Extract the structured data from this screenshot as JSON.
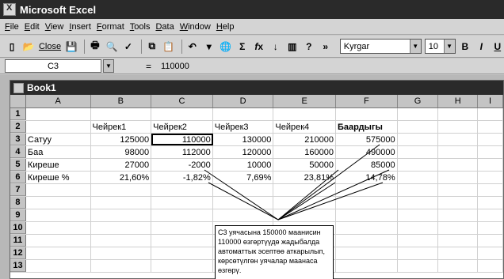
{
  "app": {
    "title": "Microsoft Excel"
  },
  "menu": [
    "File",
    "Edit",
    "View",
    "Insert",
    "Format",
    "Tools",
    "Data",
    "Window",
    "Help"
  ],
  "toolbar": {
    "close_label": "Close",
    "font": "Kyrgar",
    "size": "10",
    "bold_label": "B",
    "italic_label": "I",
    "underline_label": "U"
  },
  "formula_bar": {
    "cell_ref": "C3",
    "equals": "=",
    "value": "110000"
  },
  "workbook": {
    "title": "Book1"
  },
  "sheet": {
    "columns": [
      "A",
      "B",
      "C",
      "D",
      "E",
      "F",
      "G",
      "H",
      "I"
    ],
    "rows": [
      [
        "1",
        "",
        "",
        "",
        "",
        "",
        "",
        "",
        "",
        ""
      ],
      [
        "2",
        "",
        "Чейрек1",
        "Чейрек2",
        "Чейрек3",
        "Чейрек4",
        "Баардыгы",
        "",
        "",
        ""
      ],
      [
        "3",
        "Сатуу",
        "125000",
        "110000",
        "130000",
        "210000",
        "575000",
        "",
        "",
        ""
      ],
      [
        "4",
        "Баа",
        "98000",
        "112000",
        "120000",
        "160000",
        "490000",
        "",
        "",
        ""
      ],
      [
        "5",
        "Киреше",
        "27000",
        "-2000",
        "10000",
        "50000",
        "85000",
        "",
        "",
        ""
      ],
      [
        "6",
        "Киреше %",
        "21,60%",
        "-1,82%",
        "7,69%",
        "23,81%",
        "14,78%",
        "",
        "",
        ""
      ],
      [
        "7",
        "",
        "",
        "",
        "",
        "",
        "",
        "",
        "",
        ""
      ],
      [
        "8",
        "",
        "",
        "",
        "",
        "",
        "",
        "",
        "",
        ""
      ],
      [
        "9",
        "",
        "",
        "",
        "",
        "",
        "",
        "",
        "",
        ""
      ],
      [
        "10",
        "",
        "",
        "",
        "",
        "",
        "",
        "",
        "",
        ""
      ],
      [
        "11",
        "",
        "",
        "",
        "",
        "",
        "",
        "",
        "",
        ""
      ],
      [
        "12",
        "",
        "",
        "",
        "",
        "",
        "",
        "",
        "",
        ""
      ],
      [
        "13",
        "",
        "",
        "",
        "",
        "",
        "",
        "",
        "",
        ""
      ]
    ]
  },
  "callout": {
    "text": "C3 уячасына 150000 маанисин 110000 өзгөртүүдө жадыбалда автоматтык эсептөө аткарылып, көрсөтүлгөн уячалар маанаса өзгөрү."
  }
}
